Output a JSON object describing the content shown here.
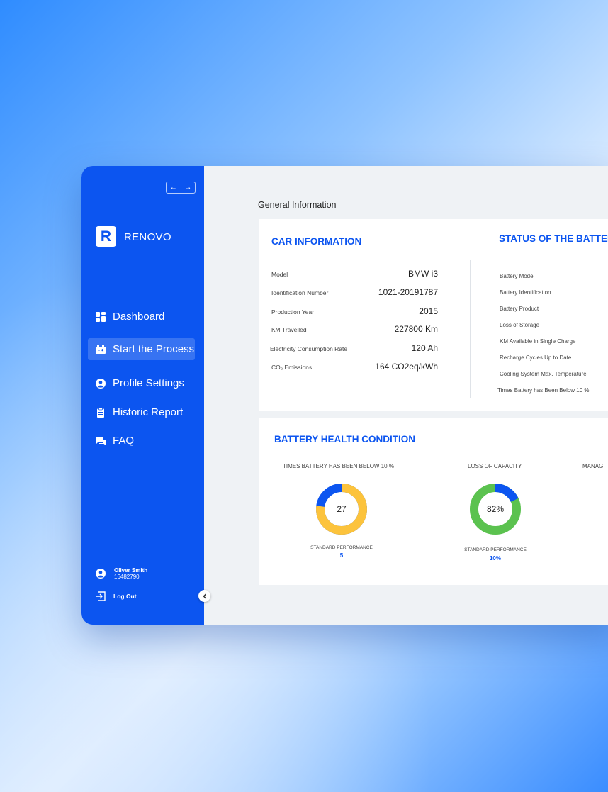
{
  "sidebar": {
    "arrow_left": "←",
    "arrow_right": "→",
    "logo_letter": "R",
    "brand": "RENOVO",
    "items": [
      {
        "label": "Dashboard",
        "icon": "dashboard-icon"
      },
      {
        "label": "Start the Process",
        "icon": "battery-icon",
        "active": true
      },
      {
        "label": "Profile Settings",
        "icon": "user-circle-icon"
      },
      {
        "label": "Historic Report",
        "icon": "clipboard-icon"
      },
      {
        "label": "FAQ",
        "icon": "chat-icon"
      }
    ],
    "user": {
      "name": "Oliver Smith",
      "id": "16482790"
    },
    "logout_label": "Log Out"
  },
  "main": {
    "section_title": "General Information",
    "car_info": {
      "title": "CAR INFORMATION",
      "rows": [
        {
          "label": "Model",
          "value": "BMW i3"
        },
        {
          "label": "Identification Number",
          "value": "1021-20191787"
        },
        {
          "label": "Production Year",
          "value": "2015"
        },
        {
          "label": "KM Travelled",
          "value": "227800 Km"
        },
        {
          "label": "Electricity Consumption Rate",
          "value": "120 Ah"
        },
        {
          "label": "CO₂ Emissions",
          "value": "164 CO2eq/kWh"
        }
      ]
    },
    "battery_status": {
      "title": "STATUS OF THE BATTER",
      "labels": [
        "Battery Model",
        "Battery Identification",
        "Battery Product",
        "Loss of Storage",
        "KM Available in Single Charge",
        "Recharge Cycles Up to Date",
        "Cooling System Max. Temperature",
        "Times Battery has Been Below 10 %"
      ]
    },
    "health": {
      "title": "BATTERY HEALTH CONDITION",
      "metrics": [
        {
          "label": "TIMES BATTERY HAS BEEN BELOW 10 %",
          "center": "27",
          "std_label": "STANDARD PERFORMANCE",
          "std_value": "5",
          "fraction": 0.23,
          "color_main": "#0c55f0",
          "color_accent": "#fcc33c"
        },
        {
          "label": "LOSS OF CAPACITY",
          "center": "82%",
          "std_label": "STANDARD PERFORMANCE",
          "std_value": "10%",
          "fraction": 0.82,
          "color_main": "#5bc24f",
          "color_accent": "#0c55f0"
        },
        {
          "label": "MANAGI"
        }
      ]
    }
  },
  "colors": {
    "brand_blue": "#0c55f0",
    "green": "#5bc24f",
    "yellow": "#fcc33c"
  }
}
